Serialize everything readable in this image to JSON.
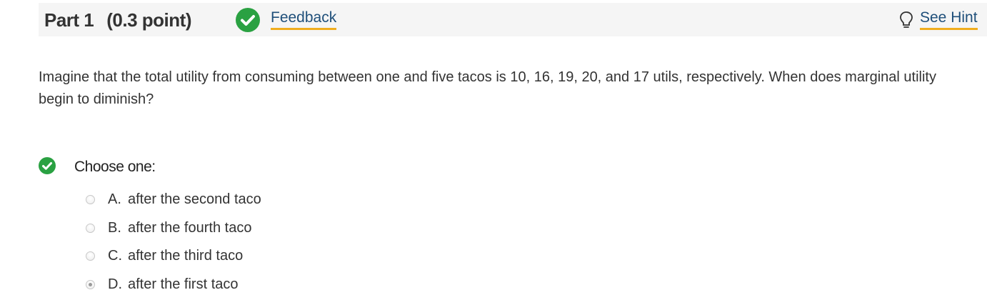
{
  "header": {
    "part_label": "Part 1",
    "points_label": "(0.3 point)",
    "feedback_label": "Feedback",
    "hint_label": "See Hint"
  },
  "question": {
    "text": "Imagine that the total utility from consuming between one and five tacos is 10, 16, 19, 20, and 17  utils, respectively. When does marginal utility begin to diminish?"
  },
  "answers": {
    "prompt": "Choose one:",
    "status": "correct",
    "choices": [
      {
        "letter": "A.",
        "text": "after the second taco",
        "selected": false
      },
      {
        "letter": "B.",
        "text": "after the fourth taco",
        "selected": false
      },
      {
        "letter": "C.",
        "text": "after the third taco",
        "selected": false
      },
      {
        "letter": "D.",
        "text": "after the first taco",
        "selected": true
      }
    ]
  },
  "icons": {
    "feedback": "check-circle-icon",
    "hint": "lightbulb-icon",
    "answer_status": "check-circle-icon"
  },
  "colors": {
    "success_green": "#2aa142",
    "link_text": "#1f4f7a",
    "link_underline": "#f0ad1e",
    "header_bg": "#f5f5f5"
  }
}
